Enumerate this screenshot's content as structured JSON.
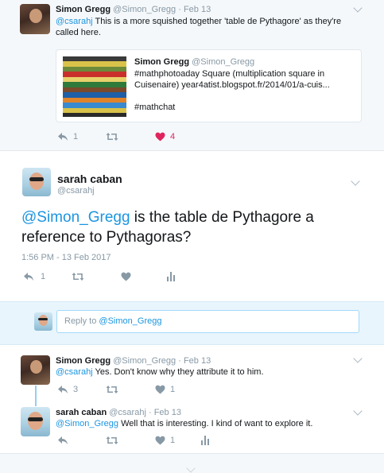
{
  "top_tweet": {
    "name": "Simon Gregg",
    "handle": "@Simon_Gregg",
    "date": "· Feb 13",
    "mention": "@csarahj",
    "text": " This is a more squished together 'table de Pythagore' as they're called here.",
    "quoted": {
      "name": "Simon Gregg",
      "handle": "@Simon_Gregg",
      "text": "#mathphotoaday Square (multiplication square in Cuisenaire) year4atist.blogspot.fr/2014/01/a-cuis...",
      "hashtag": "#mathchat"
    },
    "reply_count": "1",
    "like_count": "4"
  },
  "main_tweet": {
    "name": "sarah caban",
    "handle": "@csarahj",
    "mention": "@Simon_Gregg",
    "text": " is the table de Pythagore a reference to Pythagoras?",
    "timestamp": "1:56 PM - 13 Feb 2017",
    "reply_count": "1"
  },
  "reply_box": {
    "prefix": "Reply to ",
    "mention": "@Simon_Gregg"
  },
  "reply1": {
    "name": "Simon Gregg",
    "handle": "@Simon_Gregg",
    "date": "· Feb 13",
    "mention": "@csarahj",
    "text": " Yes. Don't know why they attribute it to him.",
    "reply_count": "3",
    "like_count": "1"
  },
  "reply2": {
    "name": "sarah caban",
    "handle": "@csarahj",
    "date": "· Feb 13",
    "mention": "@Simon_Gregg",
    "text": " Well that is interesting. I kind of want to explore it.",
    "like_count": "1"
  },
  "colors": {
    "link": "#1b95e0",
    "muted": "#8899a6",
    "like_red": "#e0245e",
    "reply_bg": "#e8f5fd"
  },
  "icons": [
    "reply-icon",
    "retweet-icon",
    "heart-icon",
    "analytics-icon",
    "chevron-down-icon"
  ]
}
